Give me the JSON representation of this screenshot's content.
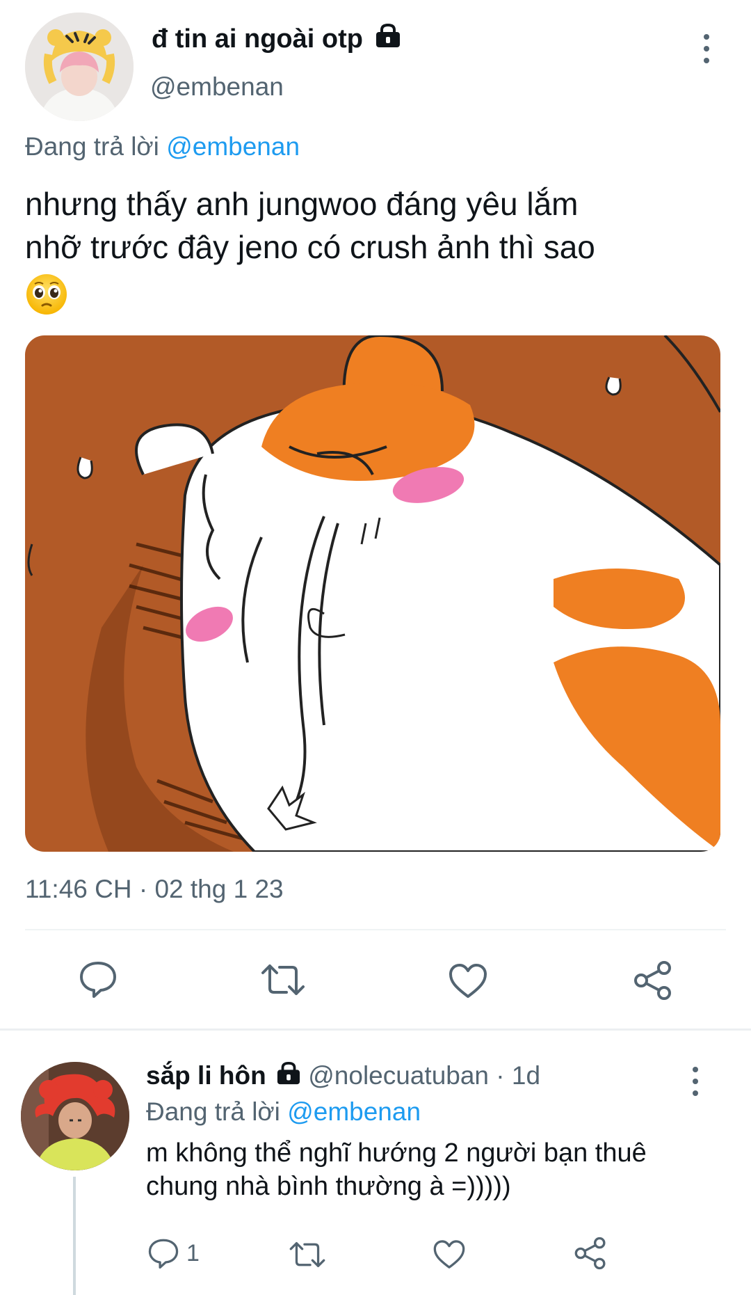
{
  "main_tweet": {
    "author_name": "đ tin ai ngoài otp",
    "handle": "@embenan",
    "reply_prefix": "Đang trả lời",
    "reply_handle": "@embenan",
    "text_line1": "nhưng thấy anh jungwoo đáng yêu lắm",
    "text_line2": "nhỡ trước đây jeno có crush ảnh thì sao",
    "emoji": "🥹",
    "timestamp": "11:46 CH · 02 thg 1 23"
  },
  "reply_tweet": {
    "author_name": "sắp li hôn",
    "handle": "@nolecuatuban",
    "time_ago": "· 1d",
    "reply_prefix": "Đang trả lời",
    "reply_handle": "@embenan",
    "text_line1": "m không thể nghĩ hướng 2 người bạn thuê",
    "text_line2": "chung nhà bình thường à =)))))",
    "reply_count": "1"
  },
  "colors": {
    "accent": "#1d9bf0",
    "muted": "#536471",
    "image_bg": "#b55d2a",
    "hamster_orange": "#ef7f22",
    "blush": "#f07ab3"
  },
  "icons": {
    "reply": "reply-icon",
    "retweet": "retweet-icon",
    "like": "heart-icon",
    "share": "share-icon",
    "lock": "lock-icon",
    "more": "more-vertical-icon"
  }
}
